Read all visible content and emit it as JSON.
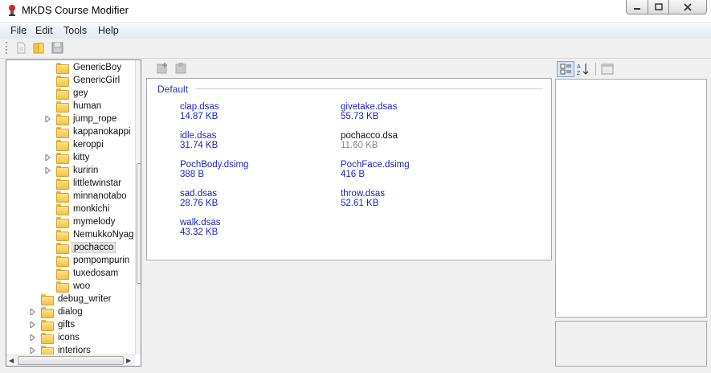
{
  "window": {
    "title": "MKDS Course Modifier"
  },
  "menu": [
    "File",
    "Edit",
    "Tools",
    "Help"
  ],
  "toolbar": {
    "icons": [
      "new-file-icon",
      "open-folder-icon",
      "save-icon"
    ]
  },
  "tree": {
    "items": [
      {
        "label": "GenericBoy",
        "level": 2,
        "expandable": false,
        "selected": false
      },
      {
        "label": "GenericGirl",
        "level": 2,
        "expandable": false,
        "selected": false
      },
      {
        "label": "gey",
        "level": 2,
        "expandable": false,
        "selected": false
      },
      {
        "label": "human",
        "level": 2,
        "expandable": false,
        "selected": false
      },
      {
        "label": "jump_rope",
        "level": 2,
        "expandable": true,
        "selected": false
      },
      {
        "label": "kappanokappi",
        "level": 2,
        "expandable": false,
        "selected": false
      },
      {
        "label": "keroppi",
        "level": 2,
        "expandable": false,
        "selected": false
      },
      {
        "label": "kitty",
        "level": 2,
        "expandable": true,
        "selected": false
      },
      {
        "label": "kuririn",
        "level": 2,
        "expandable": true,
        "selected": false
      },
      {
        "label": "littletwinstar",
        "level": 2,
        "expandable": false,
        "selected": false
      },
      {
        "label": "minnanotabo",
        "level": 2,
        "expandable": false,
        "selected": false
      },
      {
        "label": "monkichi",
        "level": 2,
        "expandable": false,
        "selected": false
      },
      {
        "label": "mymelody",
        "level": 2,
        "expandable": false,
        "selected": false
      },
      {
        "label": "NemukkoNyag",
        "level": 2,
        "expandable": false,
        "selected": false
      },
      {
        "label": "pochacco",
        "level": 2,
        "expandable": false,
        "selected": true
      },
      {
        "label": "pompompurin",
        "level": 2,
        "expandable": false,
        "selected": false
      },
      {
        "label": "tuxedosam",
        "level": 2,
        "expandable": false,
        "selected": false
      },
      {
        "label": "woo",
        "level": 2,
        "expandable": false,
        "selected": false
      },
      {
        "label": "debug_writer",
        "level": 1,
        "expandable": false,
        "selected": false
      },
      {
        "label": "dialog",
        "level": 1,
        "expandable": true,
        "selected": false
      },
      {
        "label": "gifts",
        "level": 1,
        "expandable": true,
        "selected": false
      },
      {
        "label": "icons",
        "level": 1,
        "expandable": true,
        "selected": false
      },
      {
        "label": "interiors",
        "level": 1,
        "expandable": true,
        "selected": false
      }
    ]
  },
  "files": {
    "group": "Default",
    "items": [
      {
        "name": "clap.dsas",
        "size": "14.87 KB",
        "style": "link"
      },
      {
        "name": "givetake.dsas",
        "size": "55.73 KB",
        "style": "link"
      },
      {
        "name": "idle.dsas",
        "size": "31.74 KB",
        "style": "link"
      },
      {
        "name": "pochacco.dsa",
        "size": "11.60 KB",
        "style": "plain"
      },
      {
        "name": "PochBody.dsimg",
        "size": "388 B",
        "style": "link"
      },
      {
        "name": "PochFace.dsimg",
        "size": "416 B",
        "style": "link"
      },
      {
        "name": "sad.dsas",
        "size": "28.76 KB",
        "style": "link"
      },
      {
        "name": "throw.dsas",
        "size": "52.61 KB",
        "style": "link"
      },
      {
        "name": "walk.dsas",
        "size": "43.32 KB",
        "style": "link"
      }
    ]
  },
  "property_toolbar": {
    "icons": [
      "categorized-icon",
      "alphabetical-sort-icon",
      "property-pages-icon"
    ]
  },
  "colors": {
    "link": "#1a1fc8",
    "group_header": "#1e3aa8",
    "folder": "#f2c24a"
  }
}
